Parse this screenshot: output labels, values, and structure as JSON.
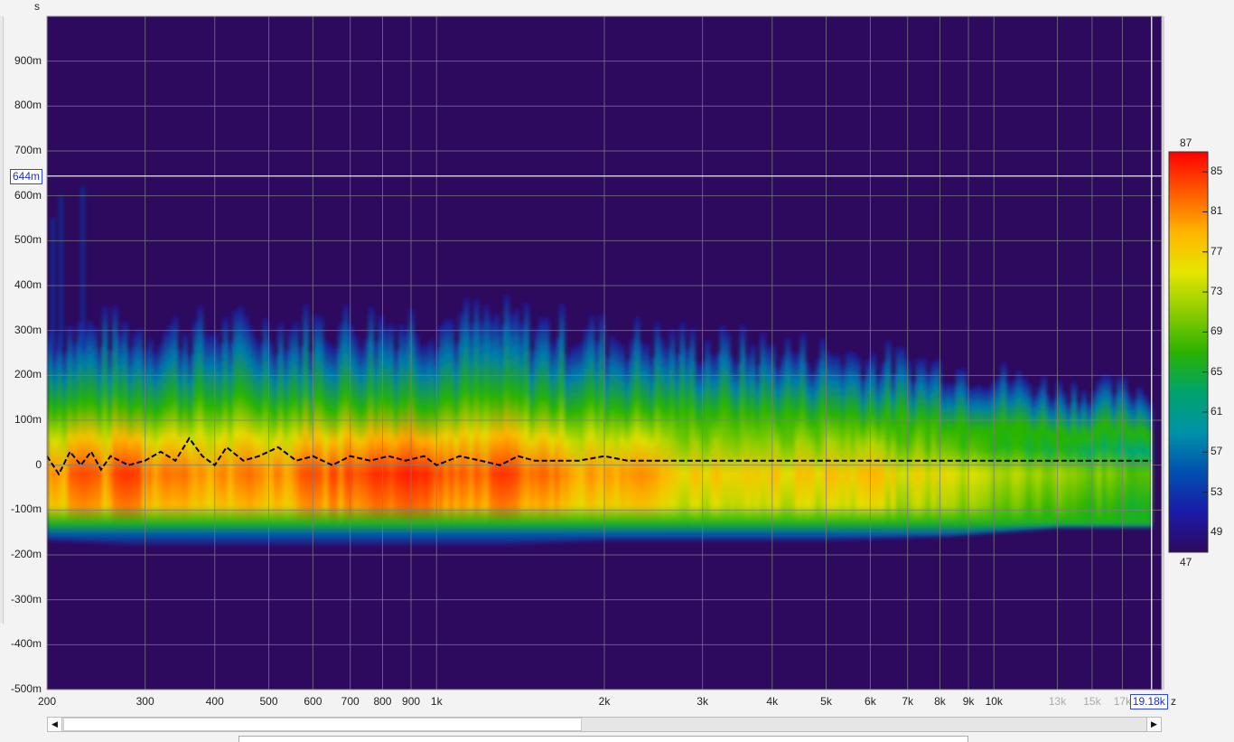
{
  "window": {
    "y_unit": "s",
    "x_unit": "z"
  },
  "markers": {
    "time_cursor": "644m",
    "freq_cursor": "19.18k"
  },
  "colorbar": {
    "top_label": "87",
    "bottom_label": "47",
    "ticks": [
      "85",
      "81",
      "77",
      "73",
      "69",
      "65",
      "61",
      "57",
      "53",
      "49"
    ],
    "colors": [
      "#ff0000",
      "#ff5a00",
      "#ffb400",
      "#e6e600",
      "#8ccd00",
      "#2bb200",
      "#00a36c",
      "#0093a8",
      "#0050b0",
      "#1a1aa8",
      "#2e0a5e"
    ]
  },
  "chart_data": {
    "type": "heatmap",
    "title": "",
    "xlabel": "Hz",
    "ylabel": "s",
    "x_scale": "log",
    "xlim": [
      200,
      20000
    ],
    "ylim": [
      -0.5,
      1.0
    ],
    "x_ticks": [
      {
        "value": 200,
        "label": "200"
      },
      {
        "value": 300,
        "label": "300"
      },
      {
        "value": 400,
        "label": "400"
      },
      {
        "value": 500,
        "label": "500"
      },
      {
        "value": 600,
        "label": "600"
      },
      {
        "value": 700,
        "label": "700"
      },
      {
        "value": 800,
        "label": "800"
      },
      {
        "value": 900,
        "label": "900"
      },
      {
        "value": 1000,
        "label": "1k"
      },
      {
        "value": 2000,
        "label": "2k"
      },
      {
        "value": 3000,
        "label": "3k"
      },
      {
        "value": 4000,
        "label": "4k"
      },
      {
        "value": 5000,
        "label": "5k"
      },
      {
        "value": 6000,
        "label": "6k"
      },
      {
        "value": 7000,
        "label": "7k"
      },
      {
        "value": 8000,
        "label": "8k"
      },
      {
        "value": 9000,
        "label": "9k"
      },
      {
        "value": 10000,
        "label": "10k"
      },
      {
        "value": 13000,
        "label": "13k",
        "dim": true
      },
      {
        "value": 15000,
        "label": "15k",
        "dim": true
      },
      {
        "value": 17000,
        "label": "17k",
        "dim": true
      }
    ],
    "y_ticks": [
      {
        "value": 0.9,
        "label": "900m"
      },
      {
        "value": 0.8,
        "label": "800m"
      },
      {
        "value": 0.7,
        "label": "700m"
      },
      {
        "value": 0.6,
        "label": "600m"
      },
      {
        "value": 0.5,
        "label": "500m"
      },
      {
        "value": 0.4,
        "label": "400m"
      },
      {
        "value": 0.3,
        "label": "300m"
      },
      {
        "value": 0.2,
        "label": "200m"
      },
      {
        "value": 0.1,
        "label": "100m"
      },
      {
        "value": 0.0,
        "label": "0"
      },
      {
        "value": -0.1,
        "label": "-100m"
      },
      {
        "value": -0.2,
        "label": "-200m"
      },
      {
        "value": -0.3,
        "label": "-300m"
      },
      {
        "value": -0.4,
        "label": "-400m"
      },
      {
        "value": -0.5,
        "label": "-500m"
      }
    ],
    "color_scale_db": [
      47,
      87
    ],
    "background_level_db": 47,
    "energy_band": {
      "x_start": 200,
      "x_end": 19180,
      "band": [
        {
          "x": 200,
          "top": 0.3,
          "bottom": -0.17,
          "peak_db": 82
        },
        {
          "x": 280,
          "top": 0.3,
          "bottom": -0.18,
          "peak_db": 84
        },
        {
          "x": 400,
          "top": 0.3,
          "bottom": -0.18,
          "peak_db": 82
        },
        {
          "x": 600,
          "top": 0.31,
          "bottom": -0.18,
          "peak_db": 84
        },
        {
          "x": 880,
          "top": 0.32,
          "bottom": -0.18,
          "peak_db": 86
        },
        {
          "x": 1300,
          "top": 0.32,
          "bottom": -0.18,
          "peak_db": 85
        },
        {
          "x": 2000,
          "top": 0.29,
          "bottom": -0.17,
          "peak_db": 81
        },
        {
          "x": 3000,
          "top": 0.27,
          "bottom": -0.17,
          "peak_db": 79
        },
        {
          "x": 5000,
          "top": 0.25,
          "bottom": -0.17,
          "peak_db": 79
        },
        {
          "x": 8000,
          "top": 0.22,
          "bottom": -0.16,
          "peak_db": 77
        },
        {
          "x": 10000,
          "top": 0.2,
          "bottom": -0.15,
          "peak_db": 75
        },
        {
          "x": 13000,
          "top": 0.17,
          "bottom": -0.14,
          "peak_db": 73
        },
        {
          "x": 19000,
          "top": 0.17,
          "bottom": -0.14,
          "peak_db": 71
        }
      ],
      "hot_spots": [
        {
          "x": 230,
          "db": 84
        },
        {
          "x": 275,
          "db": 85
        },
        {
          "x": 330,
          "db": 82
        },
        {
          "x": 450,
          "db": 82
        },
        {
          "x": 590,
          "db": 84
        },
        {
          "x": 880,
          "db": 86
        },
        {
          "x": 1300,
          "db": 85
        },
        {
          "x": 1500,
          "db": 82
        },
        {
          "x": 2300,
          "db": 81
        },
        {
          "x": 6000,
          "db": 79
        }
      ]
    },
    "series": [
      {
        "name": "",
        "style": "dashed",
        "x": [
          200,
          210,
          220,
          230,
          240,
          250,
          260,
          280,
          300,
          320,
          340,
          360,
          380,
          400,
          420,
          450,
          480,
          520,
          560,
          600,
          650,
          700,
          760,
          820,
          880,
          950,
          1000,
          1100,
          1200,
          1300,
          1400,
          1500,
          1600,
          1800,
          2000,
          2200,
          2500,
          3000,
          3500,
          4000,
          5000,
          6000,
          8000,
          10000,
          13000,
          19180
        ],
        "y": [
          0.02,
          -0.02,
          0.03,
          0.0,
          0.03,
          -0.01,
          0.02,
          0.0,
          0.01,
          0.03,
          0.01,
          0.06,
          0.02,
          0.0,
          0.04,
          0.01,
          0.02,
          0.04,
          0.01,
          0.02,
          0.0,
          0.02,
          0.01,
          0.02,
          0.01,
          0.02,
          0.0,
          0.02,
          0.01,
          0.0,
          0.02,
          0.01,
          0.01,
          0.01,
          0.02,
          0.01,
          0.01,
          0.01,
          0.01,
          0.01,
          0.01,
          0.01,
          0.01,
          0.01,
          0.01,
          0.01
        ]
      }
    ],
    "cursors": {
      "time": 0.644,
      "frequency": 19180
    },
    "grid": true
  }
}
